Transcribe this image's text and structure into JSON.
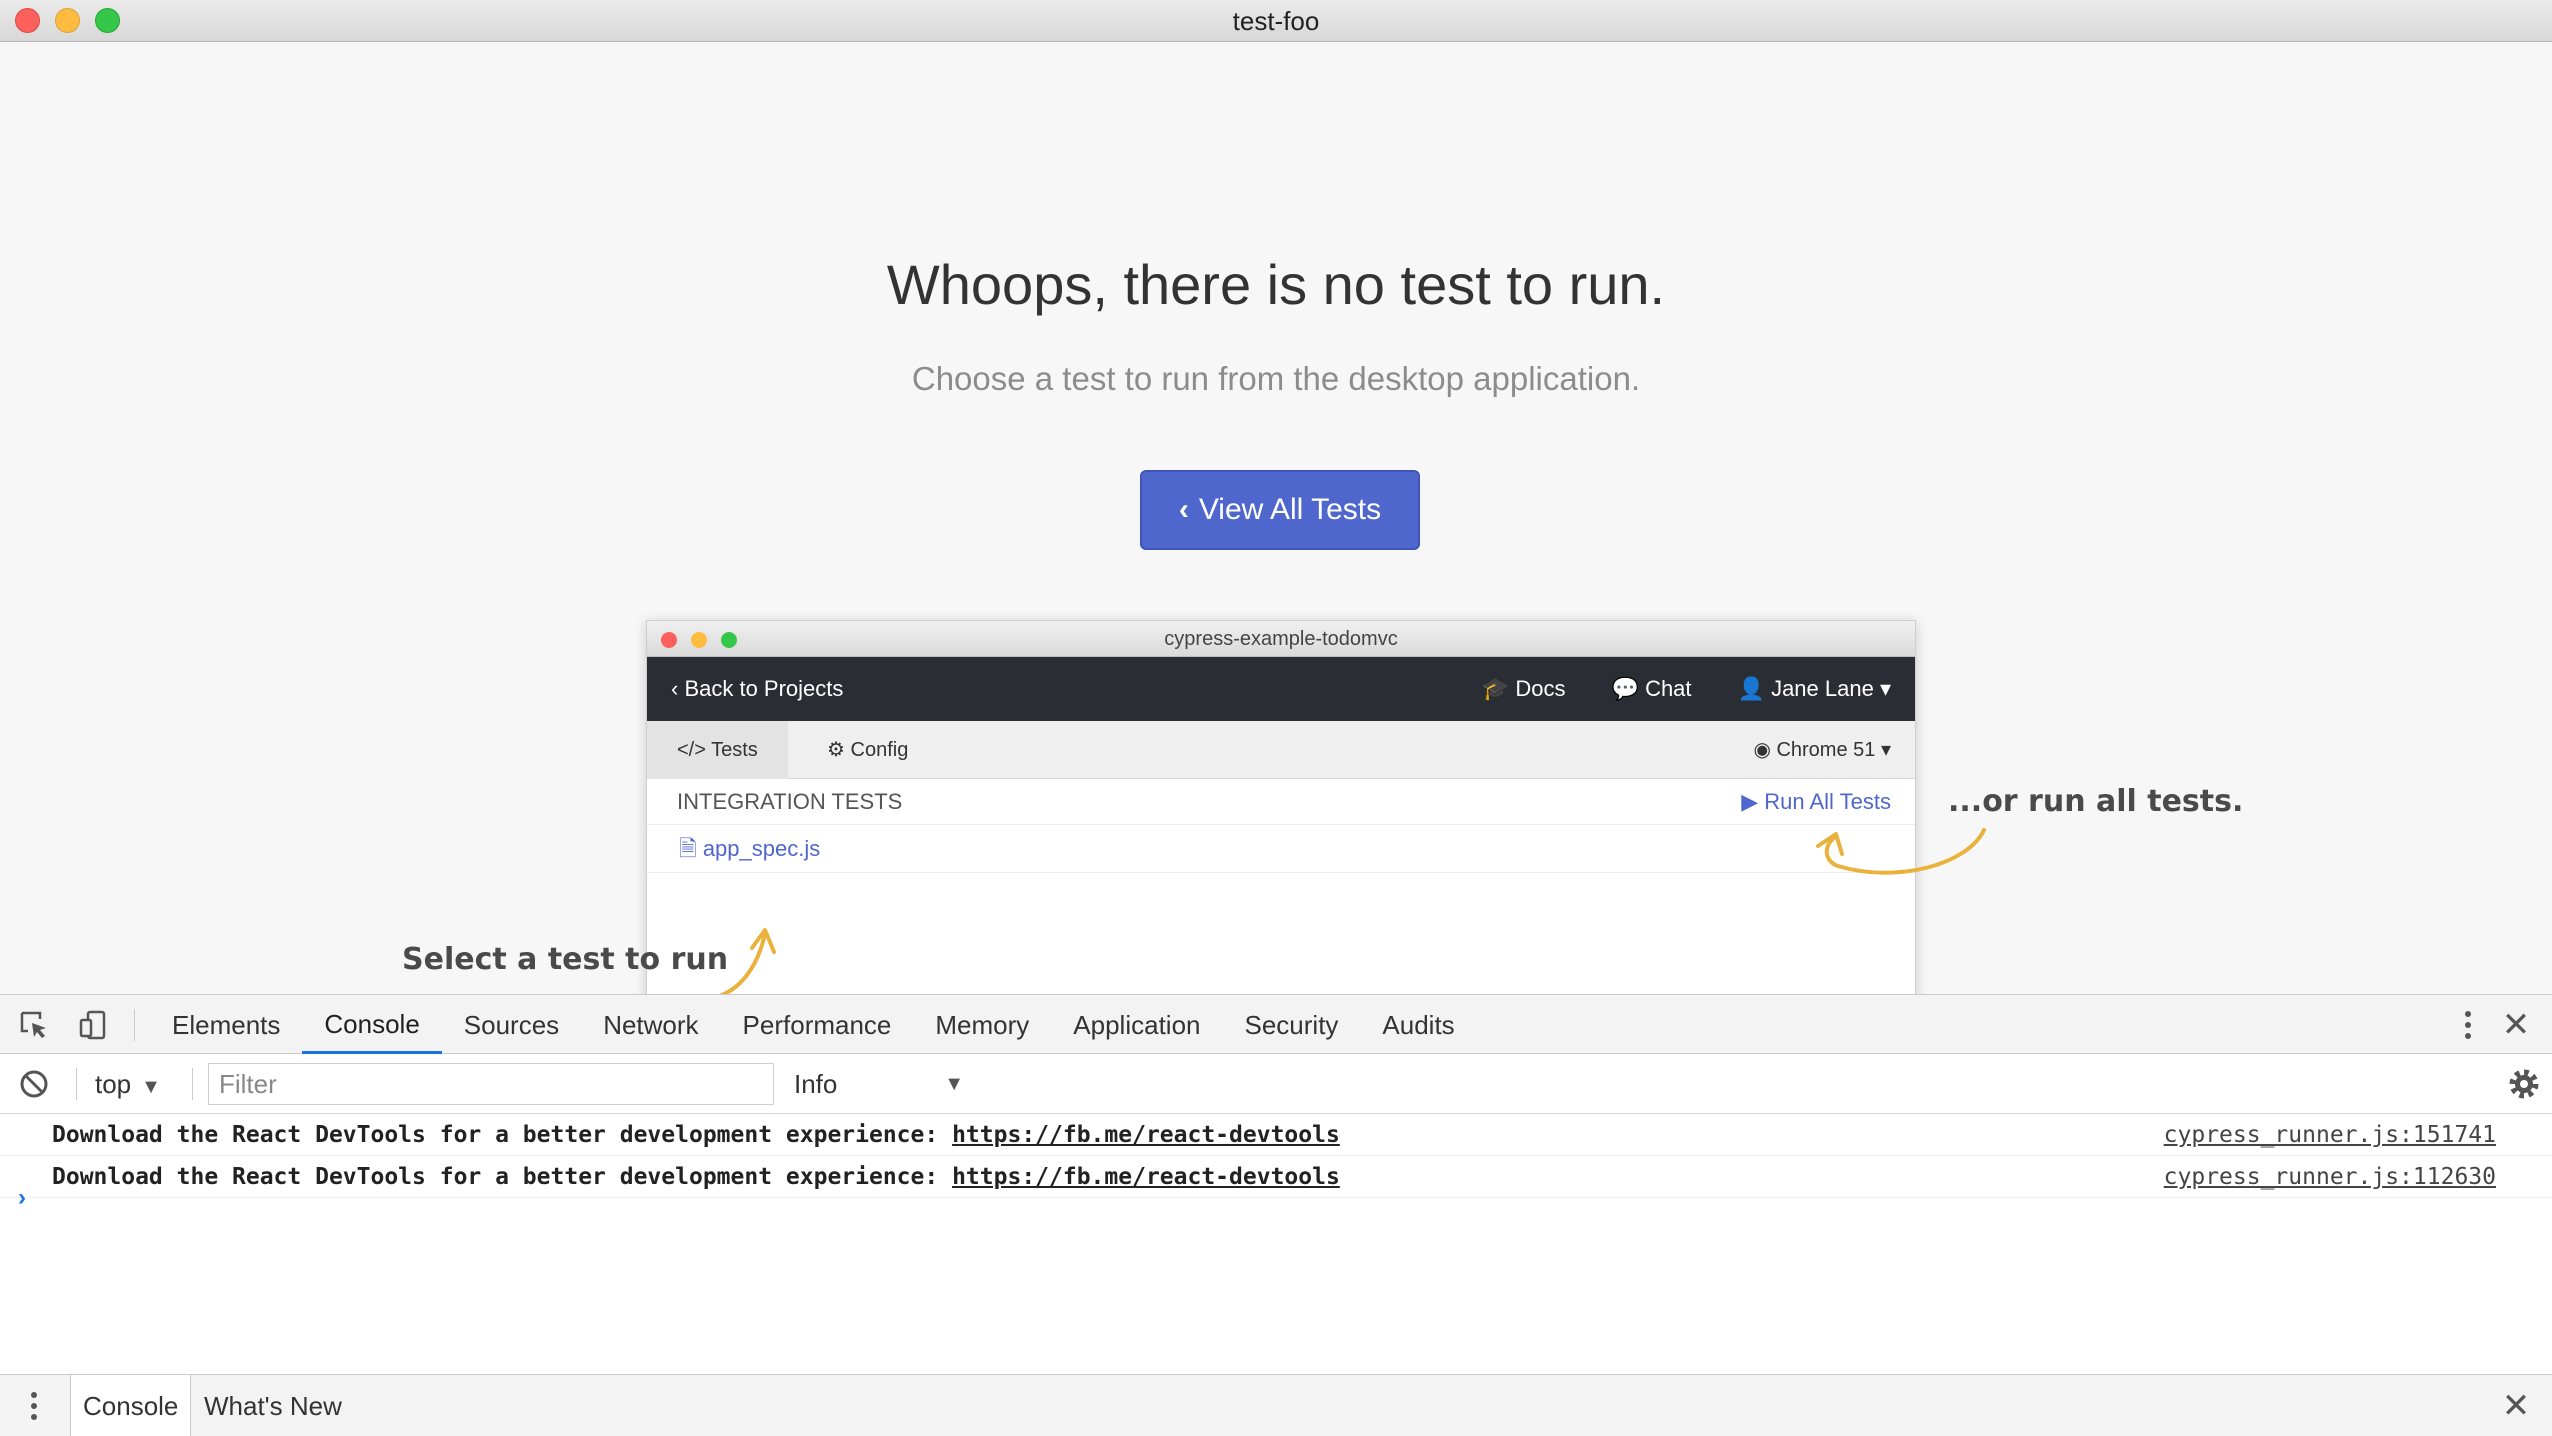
{
  "window": {
    "title": "test-foo"
  },
  "page": {
    "headline": "Whoops, there is no test to run.",
    "subline": "Choose a test to run from the desktop application.",
    "button_label": "View All Tests"
  },
  "illustration": {
    "window_title": "cypress-example-todomvc",
    "back_label": "Back to Projects",
    "nav_docs": "Docs",
    "nav_chat": "Chat",
    "nav_user": "Jane Lane",
    "tab_tests": "Tests",
    "tab_config": "Config",
    "browser": "Chrome 51",
    "section_label": "INTEGRATION TESTS",
    "run_all": "Run All Tests",
    "file": "app_spec.js",
    "note_left": "Select a test to run",
    "note_right": "...or run all tests."
  },
  "devtools": {
    "tabs": [
      "Elements",
      "Console",
      "Sources",
      "Network",
      "Performance",
      "Memory",
      "Application",
      "Security",
      "Audits"
    ],
    "active_tab": "Console",
    "context": "top",
    "filter_placeholder": "Filter",
    "level": "Info",
    "logs": [
      {
        "text": "Download the React DevTools for a better development experience: ",
        "link": "https://fb.me/react-devtools",
        "source": "cypress_runner.js:151741"
      },
      {
        "text": "Download the React DevTools for a better development experience: ",
        "link": "https://fb.me/react-devtools",
        "source": "cypress_runner.js:112630"
      }
    ],
    "prompt": "›",
    "drawer_tabs": [
      "Console",
      "What's New"
    ]
  },
  "colors": {
    "accent": "#4f67cc",
    "devtools_active": "#1a73e8"
  }
}
